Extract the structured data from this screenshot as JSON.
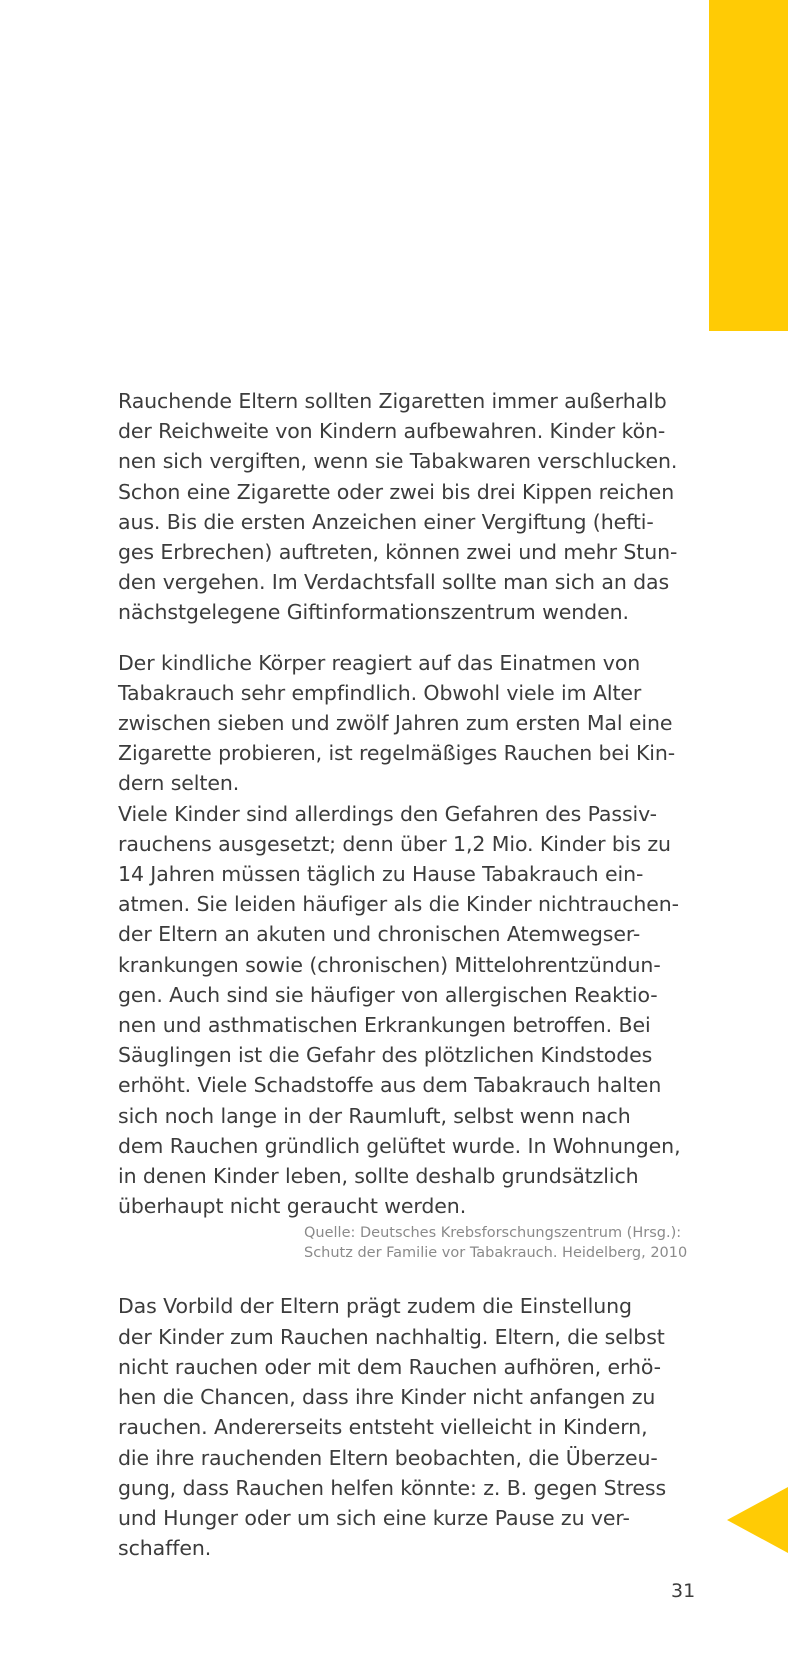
{
  "accent_color": "#ffcb05",
  "paragraph1": {
    "lines": [
      "Rauchende Eltern sollten Zigaretten immer außerhalb",
      "der Reichweite von Kindern aufbewahren. Kinder kön-",
      "nen sich vergiften, wenn sie Tabakwaren verschlucken.",
      "Schon eine Zigarette oder zwei bis drei Kippen reichen",
      "aus. Bis die ersten Anzeichen einer Vergiftung (hefti-",
      "ges Erbrechen) auftreten, können zwei und mehr Stun-",
      "den vergehen. Im Verdachtsfall sollte man sich an das",
      "nächstgelegene Giftinformationszentrum wenden."
    ]
  },
  "paragraph2": {
    "lines": [
      "Der kindliche Körper reagiert auf das Einatmen von",
      "Tabakrauch sehr empfindlich. Obwohl viele im Alter",
      "zwischen sieben und zwölf Jahren zum ersten Mal eine",
      "Zigarette probieren, ist regelmäßiges Rauchen bei Kin-",
      "dern selten.",
      "Viele Kinder sind allerdings den Gefahren des Passiv-",
      "rauchens ausgesetzt; denn über 1,2 Mio. Kinder bis zu",
      "14 Jahren müssen täglich zu Hause Tabakrauch ein-",
      "atmen. Sie leiden häufiger als die Kinder nichtrauchen-",
      "der Eltern an akuten und chronischen Atemwegser-",
      "krankungen sowie (chronischen) Mittelohrentzündun-",
      "gen. Auch sind sie häufiger von allergischen Reaktio-",
      "nen und asthmatischen Erkrankungen betroffen. Bei",
      "Säuglingen ist die Gefahr des plötzlichen Kindstodes",
      "erhöht. Viele Schadstoffe aus dem Tabakrauch halten",
      "sich noch lange in der Raumluft, selbst wenn nach",
      "dem Rauchen gründlich gelüftet wurde. In Wohnungen,",
      "in denen Kinder leben, sollte deshalb grundsätzlich",
      "überhaupt nicht geraucht werden."
    ]
  },
  "source": {
    "line1": "Quelle: Deutsches Krebsforschungszentrum (Hrsg.):",
    "line2": "Schutz der Familie vor Tabakrauch. Heidelberg, 2010"
  },
  "paragraph3": {
    "lines": [
      "Das Vorbild der Eltern prägt zudem die Einstellung",
      "der Kinder zum Rauchen nachhaltig. Eltern, die selbst",
      "nicht rauchen oder mit dem Rauchen aufhören, erhö-",
      "hen die Chancen, dass ihre Kinder nicht anfangen zu",
      "rauchen. Andererseits entsteht vielleicht in Kindern,",
      "die ihre rauchenden Eltern beobachten, die Überzeu-",
      "gung, dass Rauchen helfen könnte: z. B. gegen Stress",
      "und Hunger oder um sich eine kurze Pause zu ver-",
      "schaffen."
    ]
  },
  "page_number": "31",
  "icons": {
    "back_arrow": "triangle-left-icon"
  }
}
